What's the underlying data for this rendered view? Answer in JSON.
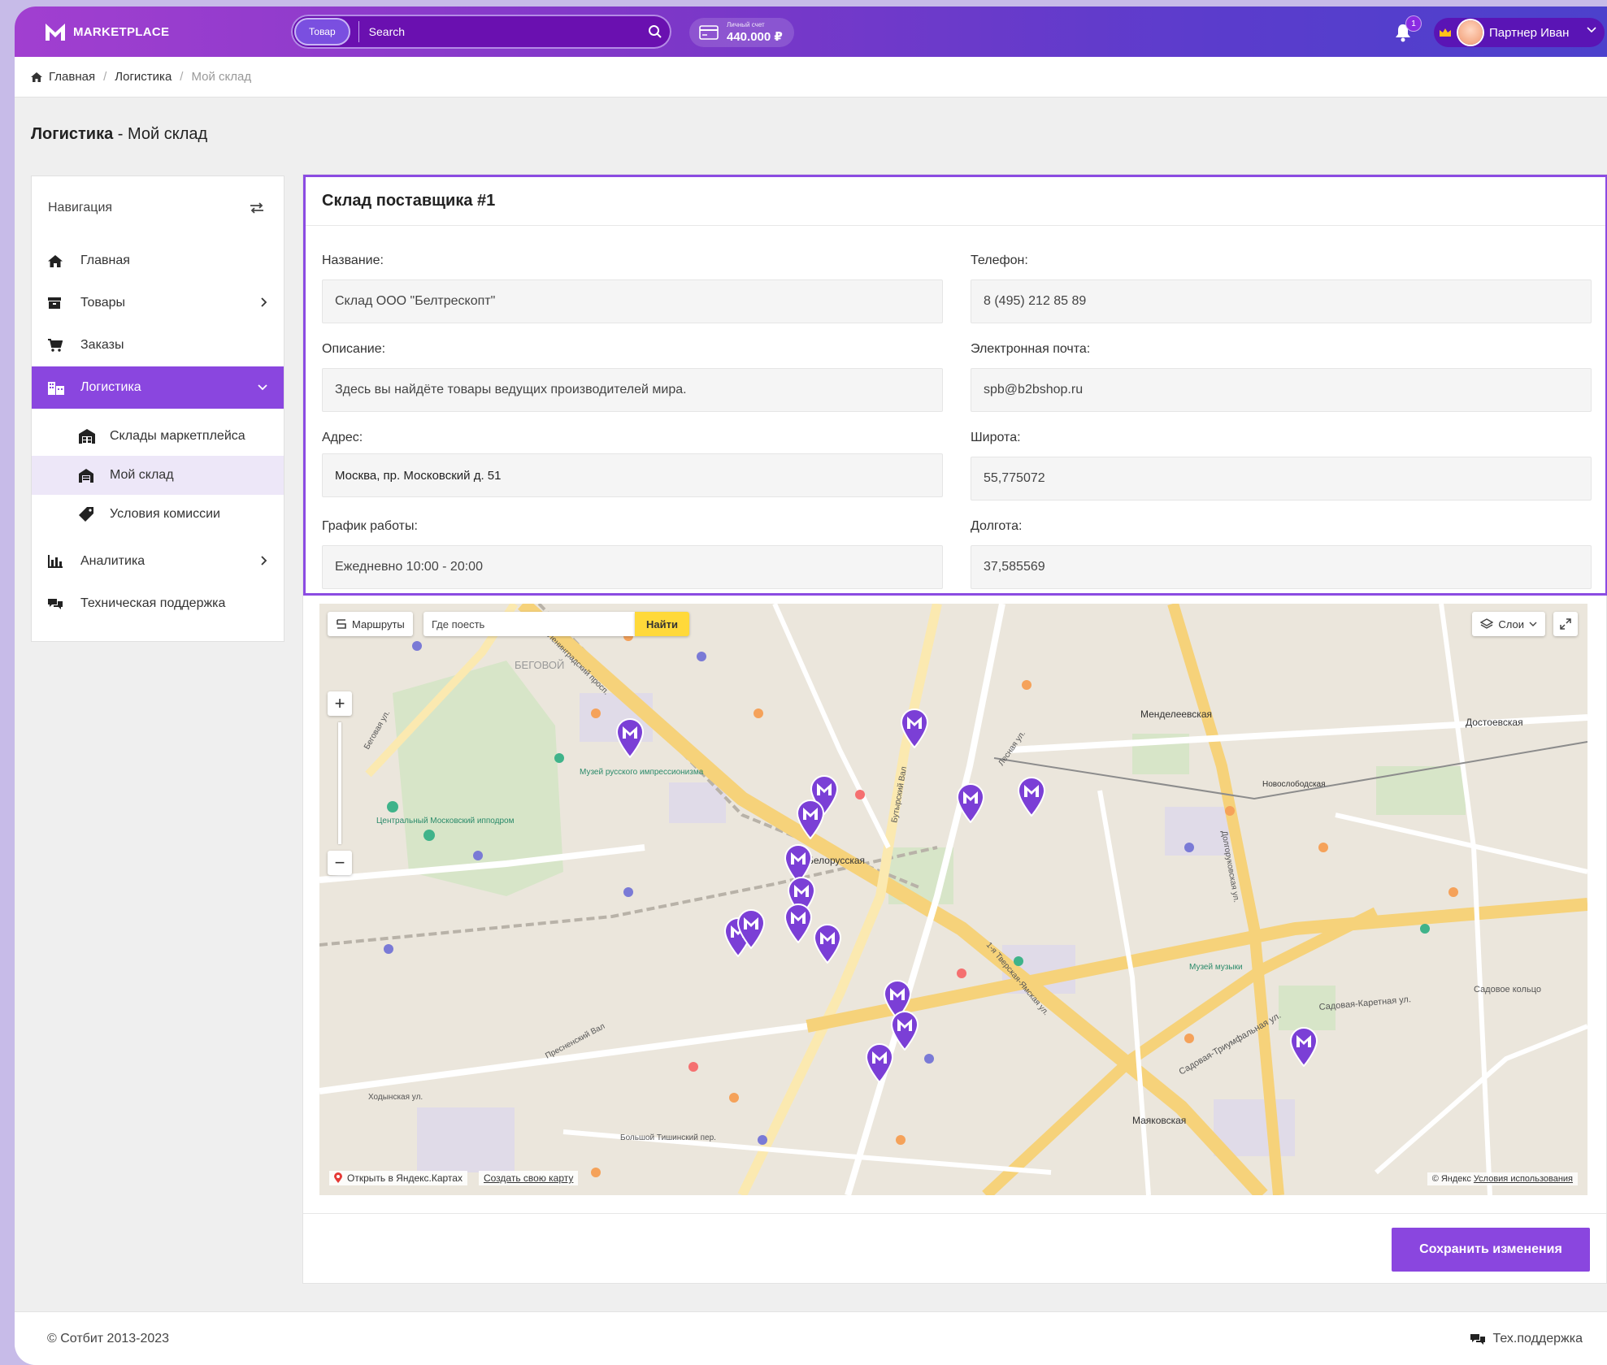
{
  "header": {
    "logo_text": "MARKETPLACE",
    "search_category": "Товар",
    "search_placeholder": "Search",
    "account_label": "Личный счет",
    "account_value": "440.000 ₽",
    "notifications_count": "1",
    "user_name": "Партнер Иван"
  },
  "breadcrumb": {
    "items": [
      "Главная",
      "Логистика",
      "Мой склад"
    ]
  },
  "page": {
    "title_bold": "Логистика",
    "title_rest": " - Мой склад"
  },
  "sidebar": {
    "title": "Навигация",
    "items": [
      {
        "label": "Главная",
        "icon": "home-icon"
      },
      {
        "label": "Товары",
        "icon": "box-icon"
      },
      {
        "label": "Заказы",
        "icon": "cart-icon"
      },
      {
        "label": "Логистика",
        "icon": "logistics-icon"
      },
      {
        "label": "Аналитика",
        "icon": "chart-icon"
      },
      {
        "label": "Техническая поддержка",
        "icon": "support-icon"
      }
    ],
    "sub_items": [
      {
        "label": "Склады маркетплейса",
        "icon": "warehouse-icon"
      },
      {
        "label": "Мой склад",
        "icon": "my-warehouse-icon"
      },
      {
        "label": "Условия комиссии",
        "icon": "tag-icon"
      }
    ]
  },
  "form": {
    "title": "Склад поставщика #1",
    "name_label": "Название:",
    "name_value": "Склад ООО \"Белтрескопт\"",
    "phone_label": "Телефон:",
    "phone_value": "8 (495) 212 85 89",
    "description_label": "Описание:",
    "description_value": "Здесь вы найдёте товары ведущих производителей мира.",
    "email_label": "Электронная почта:",
    "email_value": "spb@b2bshop.ru",
    "address_label": "Адрес:",
    "address_value": "Москва, пр. Московский д. 51",
    "latitude_label": "Широта:",
    "latitude_value": "55,775072",
    "schedule_label": "График работы:",
    "schedule_value": "Ежедневно 10:00 - 20:00",
    "longitude_label": "Долгота:",
    "longitude_value": "37,585569"
  },
  "map": {
    "routes_label": "Маршруты",
    "search_placeholder": "Где поесть",
    "find_label": "Найти",
    "layers_label": "Слои",
    "open_in_yandex": "Открыть в Яндекс.Картах",
    "create_map": "Создать свою карту",
    "copyright": "© Яндекс",
    "terms": "Условия использования",
    "labels": [
      "БЕГОВОЙ",
      "Белорусская",
      "Менделеевская",
      "Достоевская",
      "Маяковская",
      "Музей русского импрессионизма",
      "Центральный Московский ипподром",
      "Садовое кольцо",
      "Садовая-Каретная ул.",
      "Садовая-Триумфальная ул.",
      "Бутырский Вал",
      "Лесная ул.",
      "Долгоруковская ул.",
      "1-я Тверская-Ямская ул.",
      "Ленинградский просп.",
      "Беговая ул.",
      "Пресненский Вал",
      "Новослободская",
      "Музей музыки",
      "Ходынская ул.",
      "Большой Тишинский пер."
    ]
  },
  "actions": {
    "save_label": "Сохранить изменения"
  },
  "footer": {
    "copyright": "© Сотбит 2013-2023",
    "support": "Тех.поддержка"
  },
  "colors": {
    "accent": "#8a46df",
    "header_start": "#a13fd0",
    "header_end": "#4c41cc",
    "marker": "#7b3fd6"
  }
}
